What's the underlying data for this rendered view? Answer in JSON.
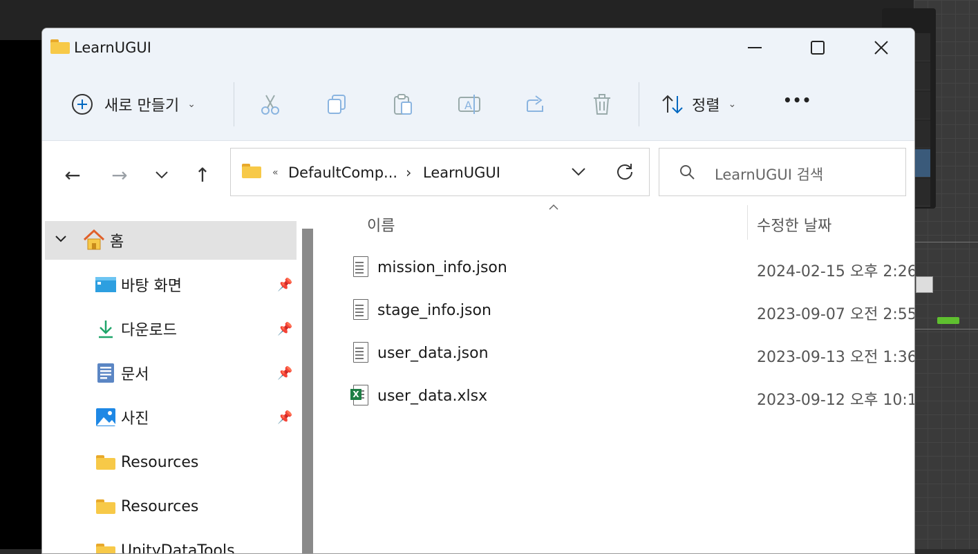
{
  "window": {
    "title": "LearnUGUI"
  },
  "titlebar_buttons": {
    "minimize": "—",
    "maximize": "☐",
    "close": "✕"
  },
  "toolbar": {
    "new_label": "새로 만들기",
    "sort_label": "정렬",
    "more_label": "•••",
    "icons": [
      "cut-icon",
      "copy-icon",
      "paste-icon",
      "rename-icon",
      "share-icon",
      "delete-icon"
    ]
  },
  "nav": {
    "back": "←",
    "forward": "→",
    "recent": "⌄",
    "up": "↑"
  },
  "address": {
    "overflow": "«",
    "crumbs": [
      "DefaultComp...",
      "LearnUGUI"
    ],
    "separator": "›"
  },
  "search": {
    "placeholder": "LearnUGUI 검색"
  },
  "sidebar": {
    "items": [
      {
        "label": "홈",
        "icon": "home-icon",
        "expanded": true,
        "selected": true
      },
      {
        "label": "바탕 화면",
        "icon": "desktop-icon",
        "pinned": true
      },
      {
        "label": "다운로드",
        "icon": "download-icon",
        "pinned": true
      },
      {
        "label": "문서",
        "icon": "documents-icon",
        "pinned": true
      },
      {
        "label": "사진",
        "icon": "pictures-icon",
        "pinned": true
      },
      {
        "label": "Resources",
        "icon": "folder-icon"
      },
      {
        "label": "Resources",
        "icon": "folder-icon"
      },
      {
        "label": "UnityDataTools",
        "icon": "folder-icon"
      }
    ]
  },
  "columns": {
    "name": "이름",
    "modified": "수정한 날짜"
  },
  "files": [
    {
      "name": "mission_info.json",
      "modified": "2024-02-15 오후 2:26",
      "type": "json"
    },
    {
      "name": "stage_info.json",
      "modified": "2023-09-07 오전 2:55",
      "type": "json"
    },
    {
      "name": "user_data.json",
      "modified": "2023-09-13 오전 1:36",
      "type": "json"
    },
    {
      "name": "user_data.xlsx",
      "modified": "2023-09-12 오후 10:1",
      "type": "xlsx"
    }
  ],
  "colors": {
    "accent": "#0067c0",
    "titlebar_bg": "#eef3f9",
    "selected_bg": "#e2e2e2",
    "folder": "#f7c948"
  }
}
